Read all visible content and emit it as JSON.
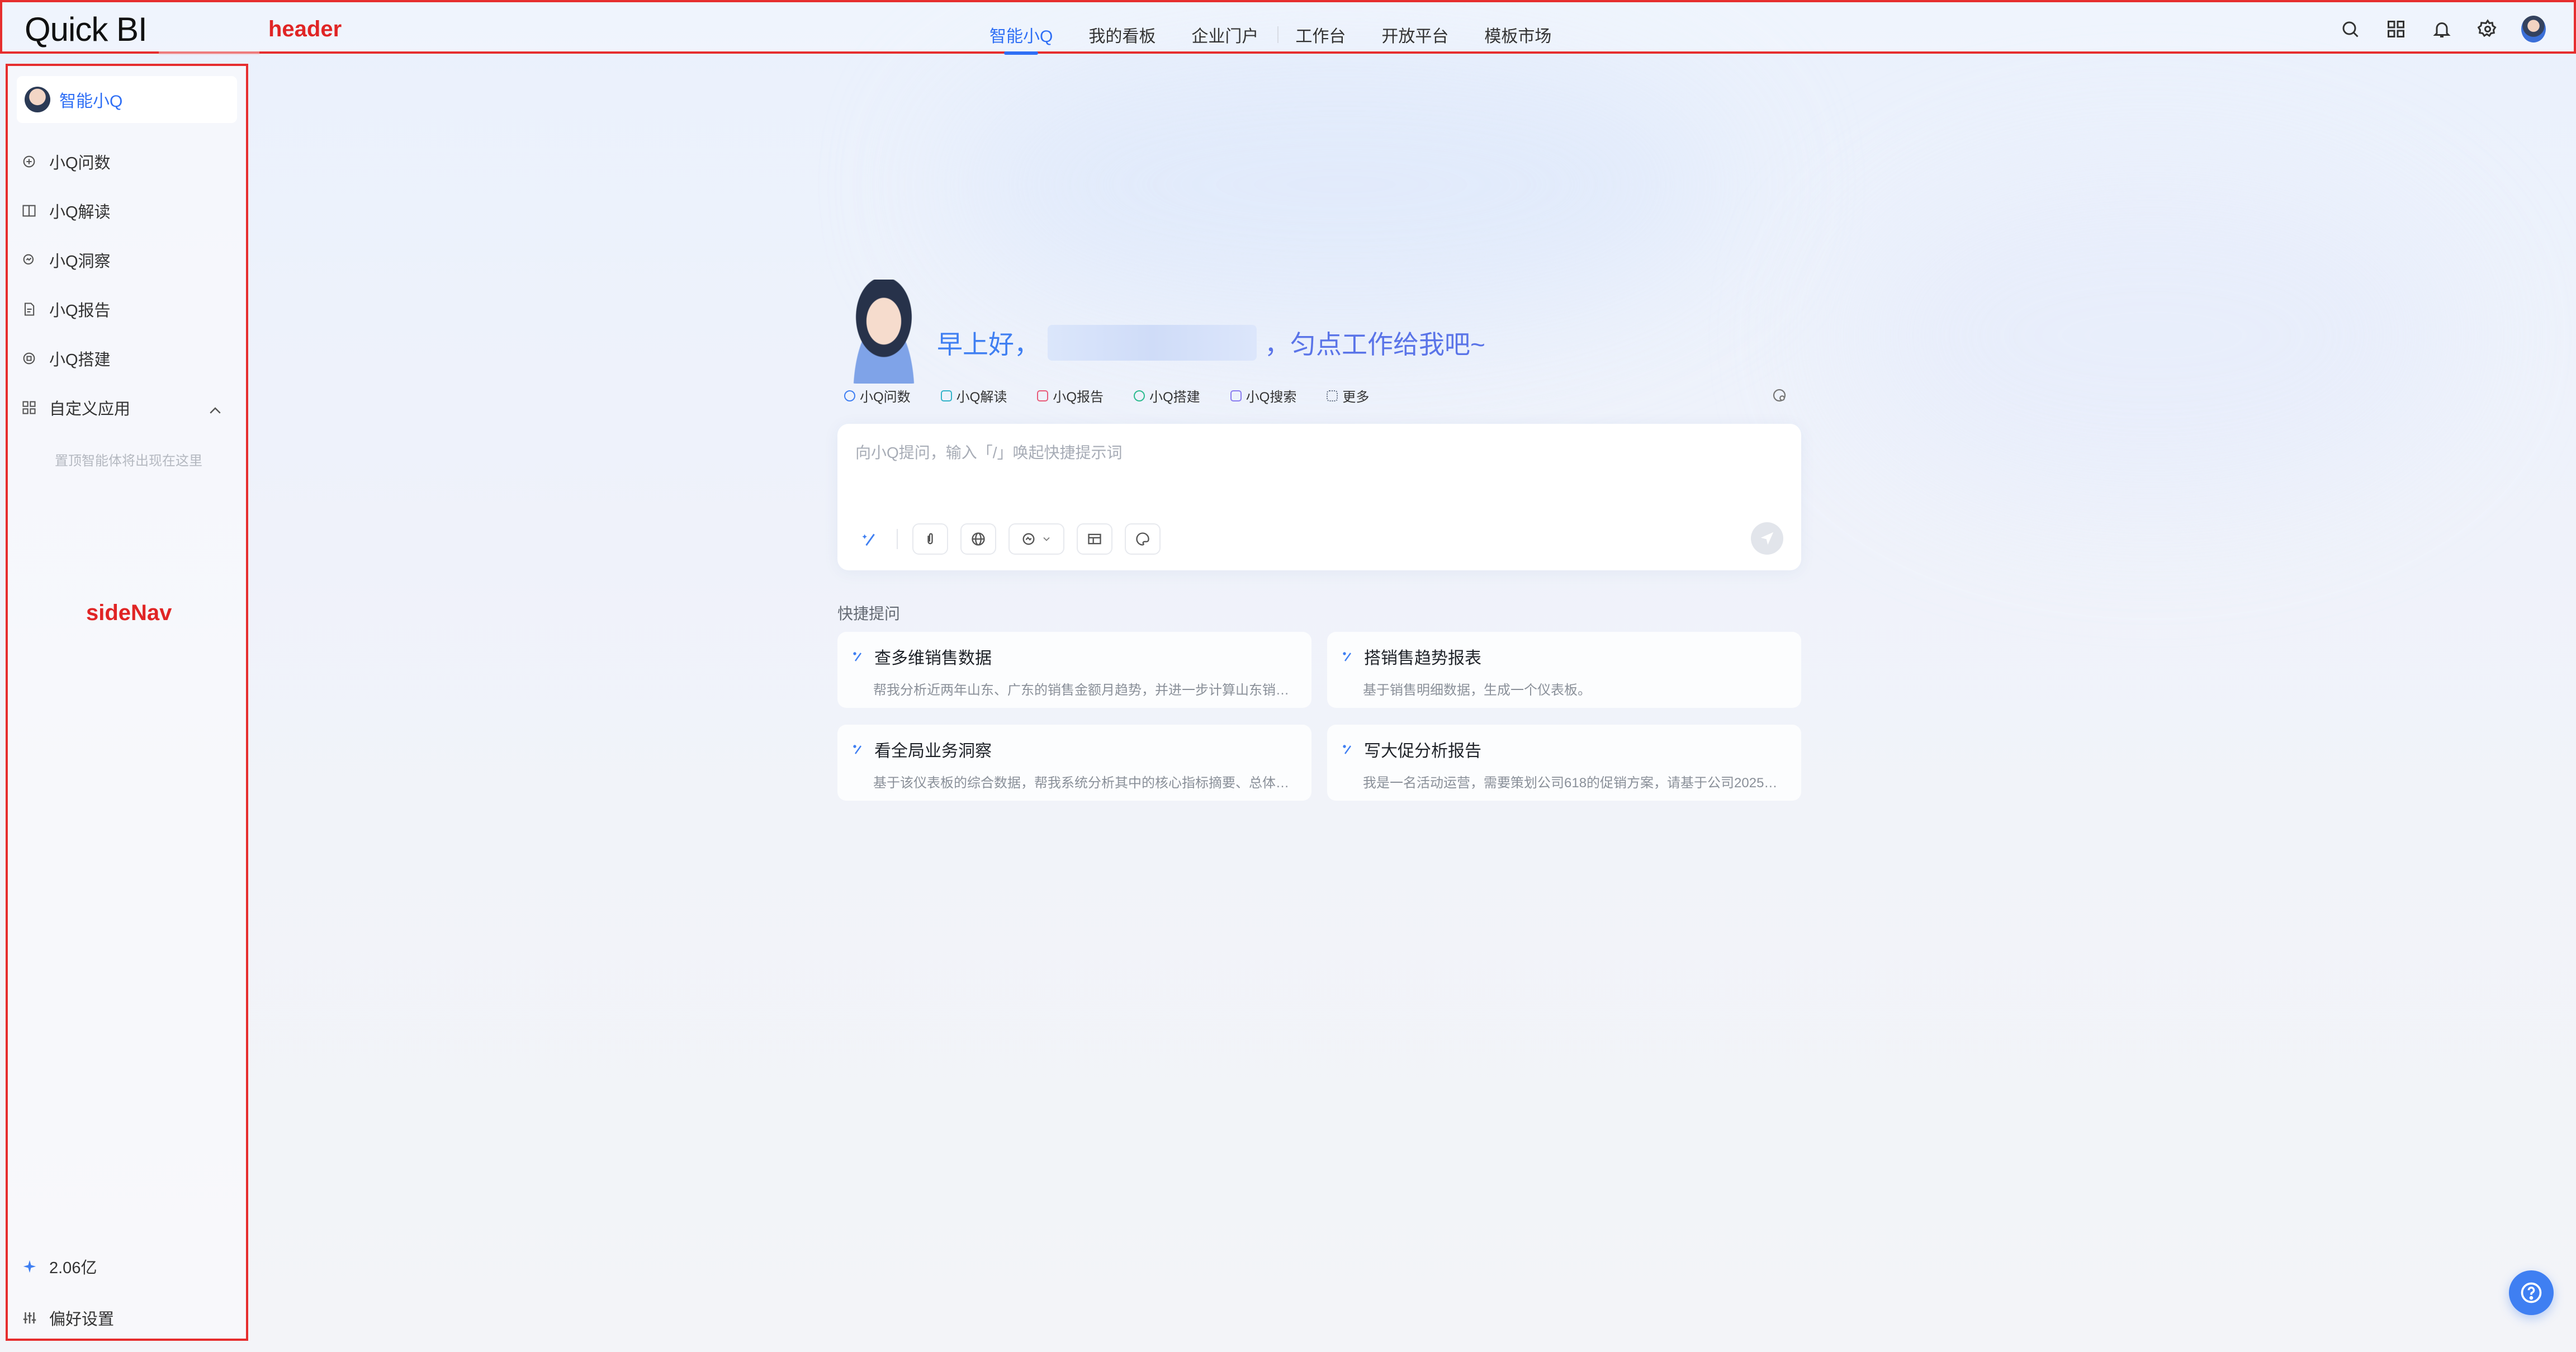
{
  "annotations": {
    "header": "header",
    "sideNav": "sideNav"
  },
  "header": {
    "logo": "Quick BI",
    "nav": [
      {
        "label": "智能小Q",
        "active": true
      },
      {
        "label": "我的看板"
      },
      {
        "label": "企业门户"
      },
      {
        "label": "工作台"
      },
      {
        "label": "开放平台"
      },
      {
        "label": "模板市场"
      }
    ],
    "icons": [
      "search-icon",
      "grid-icon",
      "bell-icon",
      "gear-icon",
      "user-avatar"
    ]
  },
  "sidebar": {
    "top": {
      "label": "智能小Q"
    },
    "items": [
      {
        "label": "小Q问数",
        "icon": "chat-data-icon"
      },
      {
        "label": "小Q解读",
        "icon": "book-icon"
      },
      {
        "label": "小Q洞察",
        "icon": "insight-icon"
      },
      {
        "label": "小Q报告",
        "icon": "report-icon"
      },
      {
        "label": "小Q搭建",
        "icon": "build-icon"
      }
    ],
    "custom": {
      "label": "自定义应用",
      "hint": "置顶智能体将出现在这里"
    },
    "quota": "2.06亿",
    "prefs": "偏好设置"
  },
  "main": {
    "greeting": {
      "prefix": "早上好，",
      "suffix": "，匀点工作给我吧~"
    },
    "chips": [
      {
        "label": "小Q问数",
        "color": "#3f7ff2"
      },
      {
        "label": "小Q解读",
        "color": "#33b3c9"
      },
      {
        "label": "小Q报告",
        "color": "#e85b7a"
      },
      {
        "label": "小Q搭建",
        "color": "#2dbb8f"
      },
      {
        "label": "小Q搜索",
        "color": "#8a7cf0"
      },
      {
        "label": "更多",
        "color": "#5f6b80"
      }
    ],
    "input": {
      "placeholder": "向小Q提问，输入「/」唤起快捷提示词"
    },
    "quick": {
      "label": "快捷提问",
      "cards": [
        {
          "title": "查多维销售数据",
          "desc": "帮我分析近两年山东、广东的销售金额月趋势，并进一步计算山东销…"
        },
        {
          "title": "搭销售趋势报表",
          "desc": "基于销售明细数据，生成一个仪表板。"
        },
        {
          "title": "看全局业务洞察",
          "desc": "基于该仪表板的综合数据，帮我系统分析其中的核心指标摘要、总体…"
        },
        {
          "title": "写大促分析报告",
          "desc": "我是一名活动运营，需要策划公司618的促销方案，请基于公司2025…"
        }
      ]
    }
  },
  "colors": {
    "accent": "#2f6ff5",
    "annotation": "#e62e2e"
  }
}
